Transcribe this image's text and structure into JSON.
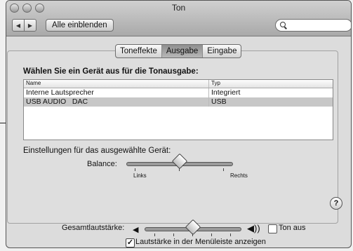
{
  "window": {
    "title": "Ton"
  },
  "toolbar": {
    "show_all_label": "Alle einblenden",
    "back_icon": "◀",
    "forward_icon": "▶"
  },
  "tabs": [
    {
      "label": "Toneffekte",
      "active": false
    },
    {
      "label": "Ausgabe",
      "active": true
    },
    {
      "label": "Eingabe",
      "active": false
    }
  ],
  "output": {
    "heading": "Wählen Sie ein Gerät aus für die Tonausgabe:",
    "columns": [
      "Name",
      "Typ"
    ],
    "rows": [
      {
        "name": "Interne Lautsprecher",
        "type": "Integriert",
        "selected": false
      },
      {
        "name": "USB AUDIO   DAC",
        "type": "USB",
        "selected": true
      }
    ]
  },
  "settings": {
    "label": "Einstellungen für das ausgewählte Gerät:",
    "balance_label": "Balance:",
    "balance_left": "Links",
    "balance_right": "Rechts",
    "balance_value": 0.5
  },
  "help": {
    "label": "?"
  },
  "volume": {
    "label": "Gesamtlautstärke:",
    "value": 0.5,
    "mute_label": "Ton aus",
    "mute_checked": false
  },
  "menubar": {
    "label": "Lautstärke in der Menüleiste anzeigen",
    "checked": true
  }
}
